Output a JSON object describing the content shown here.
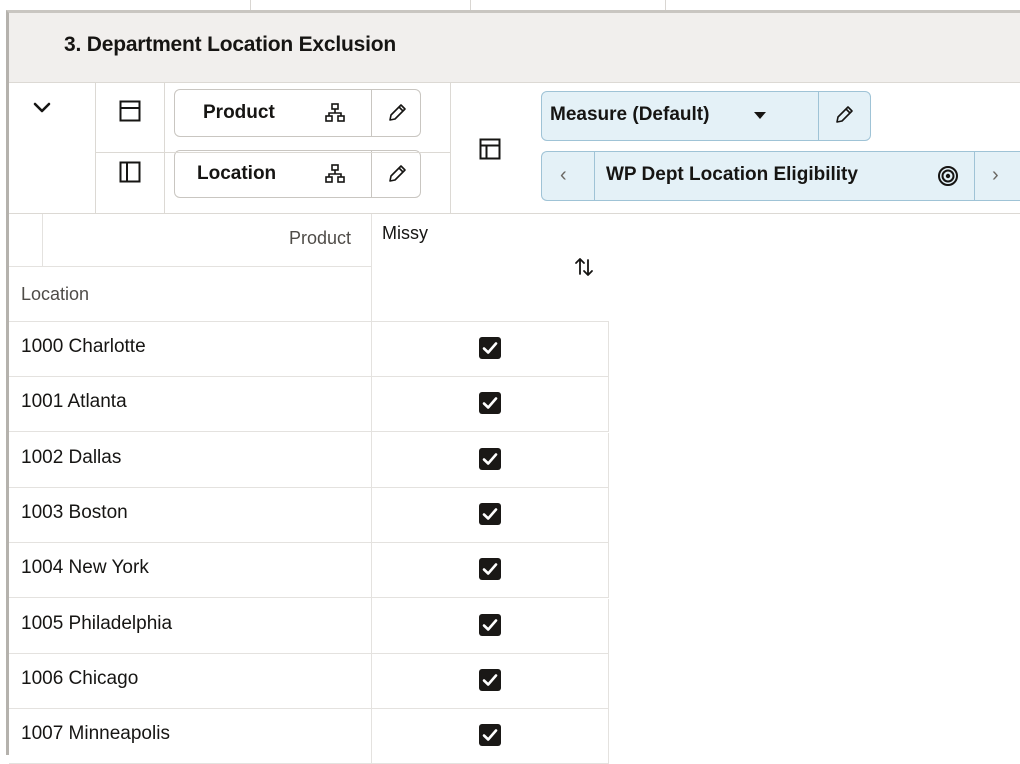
{
  "window": {
    "title": "3. Department Location Exclusion"
  },
  "toolbar": {
    "row_dimension": {
      "label": "Product",
      "icon": "hierarchy-icon",
      "edit_icon": "pencil-icon",
      "layout_icon": "rows-layout-icon"
    },
    "column_dimension": {
      "label": "Location",
      "icon": "hierarchy-icon",
      "edit_icon": "pencil-icon",
      "layout_icon": "columns-layout-icon"
    },
    "collapse_icon": "chevron-down-icon",
    "pivot_icon": "pivot-layout-icon",
    "measure_profile": {
      "label": "Measure (Default)",
      "dropdown_icon": "caret-down-icon",
      "edit_icon": "pencil-icon"
    },
    "measure_selector": {
      "label": "WP Dept Location Eligibility",
      "prev_icon": "chevron-left-icon",
      "next_icon": "chevron-right-icon",
      "target_icon": "target-icon"
    }
  },
  "grid": {
    "product_header": "Product",
    "location_header": "Location",
    "column_member": "Missy",
    "sort_icon": "sort-icon",
    "rows": [
      {
        "location": "1000 Charlotte",
        "eligible": true
      },
      {
        "location": "1001 Atlanta",
        "eligible": true
      },
      {
        "location": "1002 Dallas",
        "eligible": true
      },
      {
        "location": "1003 Boston",
        "eligible": true
      },
      {
        "location": "1004 New York",
        "eligible": true
      },
      {
        "location": "1005 Philadelphia",
        "eligible": true
      },
      {
        "location": "1006 Chicago",
        "eligible": true
      },
      {
        "location": "1007 Minneapolis",
        "eligible": true
      }
    ]
  },
  "colors": {
    "title_bar_bg": "#f1efed",
    "measure_bg": "#e4f1f7",
    "measure_border": "#9fc3d6",
    "checkbox": "#1a1816"
  }
}
